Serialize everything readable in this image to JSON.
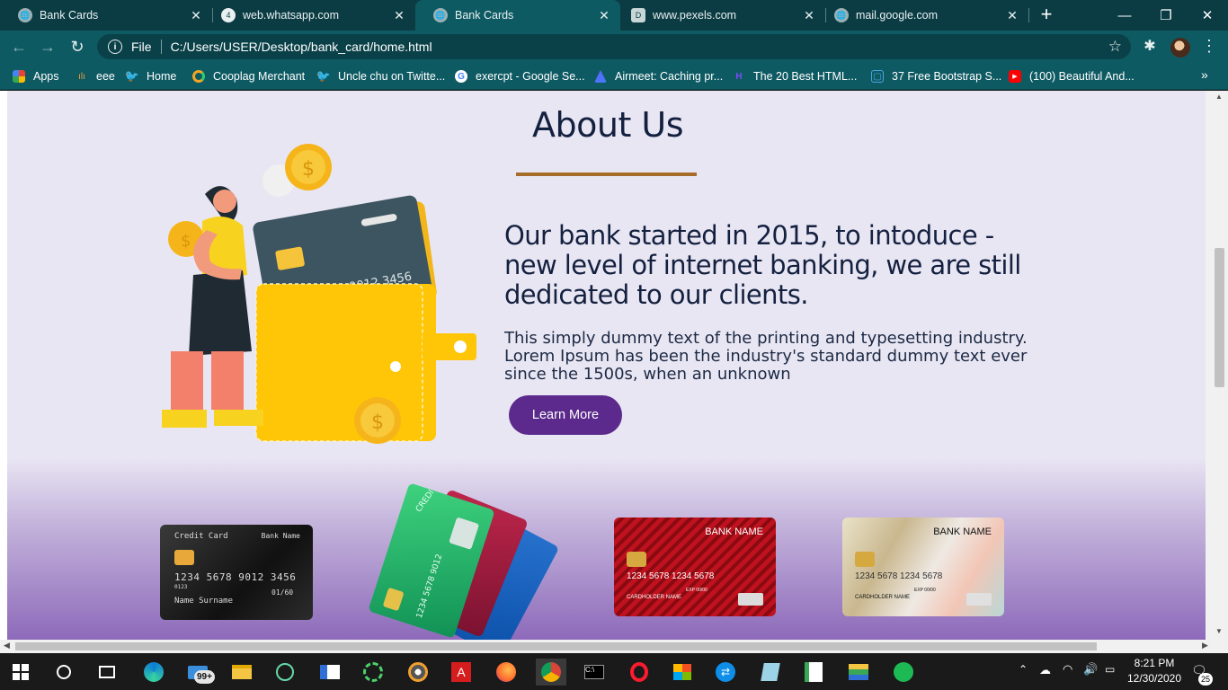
{
  "tabs": [
    {
      "title": "Bank Cards",
      "active": false
    },
    {
      "title": "web.whatsapp.com",
      "active": false
    },
    {
      "title": "Bank Cards",
      "active": true
    },
    {
      "title": "www.pexels.com",
      "active": false
    },
    {
      "title": "mail.google.com",
      "active": false
    }
  ],
  "tab_badges": {
    "whatsapp": "4",
    "pexels": "D"
  },
  "window_controls": {
    "minimize": "—",
    "restore": "❐",
    "close": "✕"
  },
  "address_bar": {
    "scheme_label": "File",
    "url": "C:/Users/USER/Desktop/bank_card/home.html"
  },
  "bookmarks": [
    {
      "label": "Apps",
      "icon": "apps-grid-icon"
    },
    {
      "label": "eee",
      "icon": "chart-icon"
    },
    {
      "label": "Home",
      "icon": "twitter-icon"
    },
    {
      "label": "Cooplag Merchant",
      "icon": "cooplag-icon"
    },
    {
      "label": "Uncle chu on Twitte...",
      "icon": "twitter-icon"
    },
    {
      "label": "exercpt - Google Se...",
      "icon": "google-icon"
    },
    {
      "label": "Airmeet: Caching pr...",
      "icon": "airmeet-icon"
    },
    {
      "label": "The 20 Best HTML...",
      "icon": "html-icon"
    },
    {
      "label": "37 Free Bootstrap S...",
      "icon": "bootstrap-icon"
    },
    {
      "label": "(100) Beautiful And...",
      "icon": "youtube-icon"
    }
  ],
  "page": {
    "heading": "About Us",
    "lead": "Our bank started in 2015, to intoduce - new level of internet banking, we are still dedicated to our clients.",
    "body": "This simply dummy text of the printing and typesetting industry. Lorem Ipsum has been the industry's standard dummy text ever since the 1500s, when an unknown",
    "cta": "Learn More",
    "illustration_card_number": "1234 5678 9012 3456",
    "cards": {
      "black": {
        "type_label": "Credit Card",
        "bank_label": "Bank Name",
        "number": "1234  5678  9012  3456",
        "small_number": "0123",
        "expiry": "01/60",
        "holder": "Name Surname"
      },
      "fan": {
        "label": "CREDIT CARD",
        "number": "1234 5678 9012"
      },
      "red": {
        "bank_label": "BANK NAME",
        "number": "1234   5678   1234   5678",
        "holder": "CARDHOLDER NAME",
        "expiry": "EXP 00/00"
      },
      "pearl": {
        "bank_label": "BANK NAME",
        "number": "1234   5678   1234   5678",
        "holder": "CARDHOLDER NAME",
        "expiry": "EXP 00/00"
      }
    }
  },
  "taskbar": {
    "mail_badge": "99+",
    "time": "8:21 PM",
    "date": "12/30/2020",
    "notification_count": "25"
  },
  "colors": {
    "tabstrip": "#0b3c44",
    "toolbar": "#0e5a63",
    "heading": "#13203f",
    "rule": "#a66d2a",
    "cta": "#5b2a8c",
    "page_bg": "#e9e6f3"
  }
}
